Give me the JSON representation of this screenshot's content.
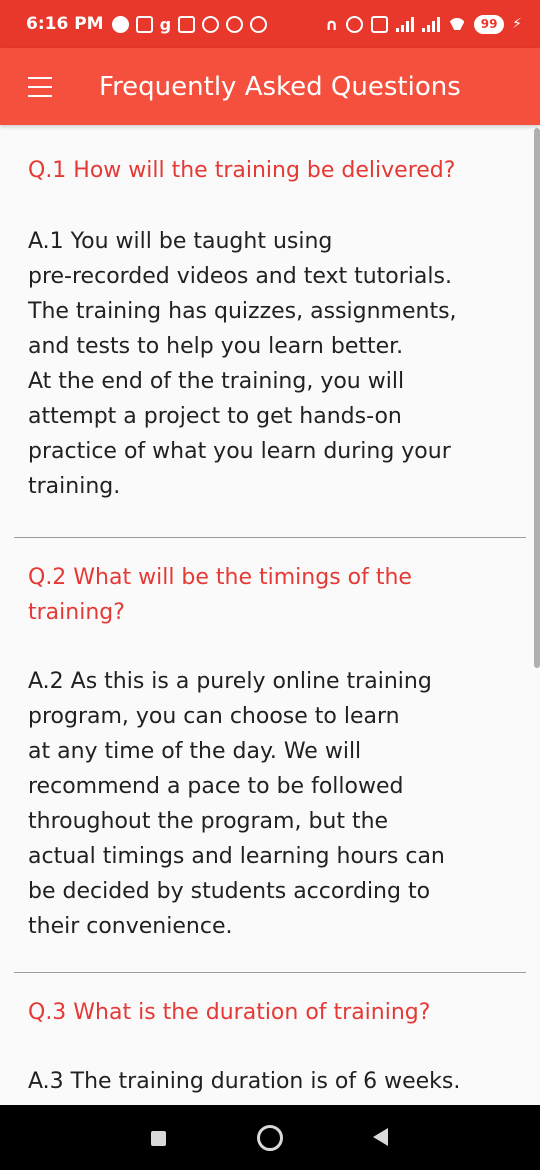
{
  "status_bar": {
    "time": "6:16 PM",
    "battery": "99",
    "left_icons": [
      "plus-circle-icon",
      "instagram-icon",
      "g-icon",
      "tl-icon",
      "chrome-icon",
      "whatsapp-icon",
      "whatsapp-icon"
    ],
    "right_icons": [
      "headset-icon",
      "alarm-icon",
      "volte-icon",
      "signal-icon",
      "signal-icon",
      "wifi-icon",
      "battery-icon",
      "charging-icon"
    ]
  },
  "app_bar": {
    "title": "Frequently Asked Questions",
    "menu_icon": "hamburger-menu-icon"
  },
  "faq": [
    {
      "question": "Q.1 How will the training be delivered?",
      "answer": "A.1 You will be taught using\npre-recorded videos and text tutorials.\nThe training has quizzes, assignments,\nand tests to help you learn better.\nAt the end of the training, you will\nattempt a project to get hands-on\npractice of what you learn during your\ntraining."
    },
    {
      "question": "Q.2 What will be the timings of the\ntraining?",
      "answer": "A.2 As this is a purely online training\nprogram, you can choose to learn\nat any time of the day. We will\nrecommend a pace to be followed\nthroughout the program, but the\nactual timings and learning hours can\nbe decided by students according to\ntheir convenience."
    },
    {
      "question": "Q.3 What is the duration of training?",
      "answer": "A.3 The training duration is of 6 weeks."
    }
  ],
  "colors": {
    "status_bar": "#e8382c",
    "app_bar": "#f5503e",
    "question_text": "#e53935",
    "answer_text": "#212121",
    "background": "#fafafa"
  }
}
